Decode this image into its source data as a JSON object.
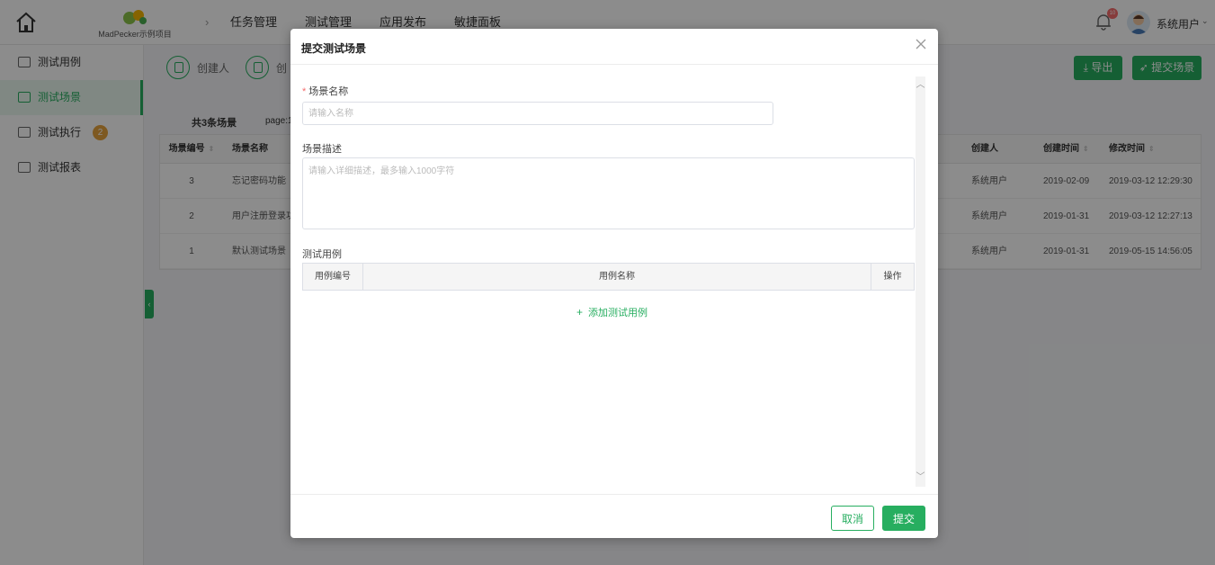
{
  "header": {
    "logo_text": "MadPecker示例项目",
    "nav": [
      "任务管理",
      "测试管理",
      "应用发布",
      "敏捷面板"
    ],
    "active_nav": "测试管理",
    "notification_count": "10",
    "user_name": "系统用户"
  },
  "sidebar": {
    "items": [
      {
        "label": "测试用例"
      },
      {
        "label": "测试场景"
      },
      {
        "label": "测试执行",
        "badge": "2"
      },
      {
        "label": "测试报表"
      }
    ]
  },
  "toolbar": {
    "filters": [
      "创建人",
      "创"
    ],
    "export_label": "导出",
    "submit_scene_label": "提交场景"
  },
  "list": {
    "summary": "共3条场景",
    "page_info": "page:1",
    "columns": {
      "id": "场景编号",
      "name": "场景名称",
      "creator": "创建人",
      "created": "创建时间",
      "modified": "修改时间"
    },
    "rows": [
      {
        "id": "3",
        "name": "忘记密码功能",
        "creator": "系统用户",
        "created": "2019-02-09",
        "modified": "2019-03-12 12:29:30"
      },
      {
        "id": "2",
        "name": "用户注册登录功",
        "creator": "系统用户",
        "created": "2019-01-31",
        "modified": "2019-03-12 12:27:13"
      },
      {
        "id": "1",
        "name": "默认测试场景",
        "creator": "系统用户",
        "created": "2019-01-31",
        "modified": "2019-05-15 14:56:05"
      }
    ]
  },
  "dialog": {
    "title": "提交测试场景",
    "name_label": "场景名称",
    "name_value": "",
    "name_placeholder": "请输入名称",
    "desc_label": "场景描述",
    "desc_value": "",
    "desc_placeholder": "请输入详细描述，最多输入1000字符",
    "cases_label": "测试用例",
    "case_columns": {
      "no": "用例编号",
      "name": "用例名称",
      "op": "操作"
    },
    "add_case_label": "添加测试用例",
    "cancel_label": "取消",
    "submit_label": "提交"
  },
  "colors": {
    "accent": "#27ae60",
    "badge": "#e6a23c",
    "danger": "#f56c6c"
  }
}
